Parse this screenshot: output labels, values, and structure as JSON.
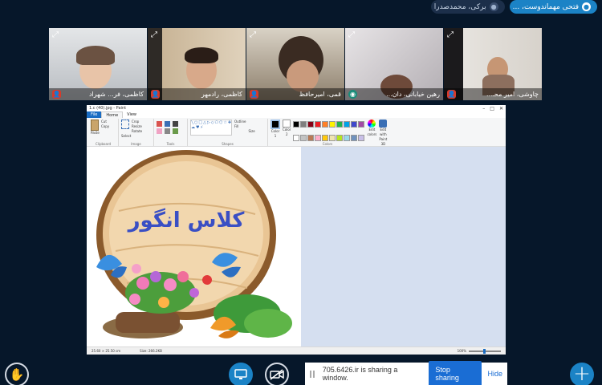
{
  "talkers": [
    {
      "name": "فتحی مهماندوست، ...",
      "state": "active"
    },
    {
      "name": "برکی، محمدصدرا",
      "state": "idle"
    }
  ],
  "tiles": [
    {
      "name": "کاظمی، فر... شهراد",
      "icon": "user-icon",
      "bg": "#cfd2d6"
    },
    {
      "name": "کاظمی، رادمهر",
      "icon": "user-icon",
      "bg": "#b9a88f"
    },
    {
      "name": "قمی، امیرحافظ",
      "icon": "user-icon",
      "bg": "#a79a88"
    },
    {
      "name": "رهین خیابانی، دان...",
      "icon": "headset-icon",
      "bg": "#c8c4c6"
    },
    {
      "name": "چاوشی، امیر محـ...",
      "icon": "user-icon",
      "bg": "#dedbd6"
    }
  ],
  "paint": {
    "title": "1.c (40).jpg - Paint",
    "menu": {
      "file": "File",
      "home": "Home",
      "view": "View"
    },
    "groups": {
      "clipboard": "Clipboard",
      "image": "Image",
      "tools": "Tools",
      "shapes": "Shapes",
      "colors": "Colors"
    },
    "clipboard_items": [
      "Paste",
      "Cut",
      "Copy"
    ],
    "image_items": [
      "Select",
      "Crop",
      "Resize",
      "Rotate"
    ],
    "shape_items": [
      "Outline",
      "Fill",
      "Size"
    ],
    "color_items": [
      "Color 1",
      "Color 2",
      "Edit colors",
      "Edit with Paint 3D"
    ],
    "palette": [
      "#000000",
      "#7f7f7f",
      "#880015",
      "#ed1c24",
      "#ff7f27",
      "#fff200",
      "#22b14c",
      "#00a2e8",
      "#3f48cc",
      "#a349a4",
      "#ffffff",
      "#c3c3c3",
      "#b97a57",
      "#ffaec9",
      "#ffc90e",
      "#efe4b0",
      "#b5e61d",
      "#99d9ea",
      "#7092be",
      "#c8bfe7"
    ],
    "status": {
      "position": "25.60 × 25.50 cm",
      "size": "Size: 266.2KB",
      "zoom": "100%"
    },
    "sign_text": "کلاس انگور"
  },
  "share": {
    "message": "705.6426.ir is sharing a window.",
    "stop": "Stop sharing",
    "hide": "Hide"
  },
  "controls": {
    "hand": "raise-hand-icon",
    "plus": "+"
  }
}
